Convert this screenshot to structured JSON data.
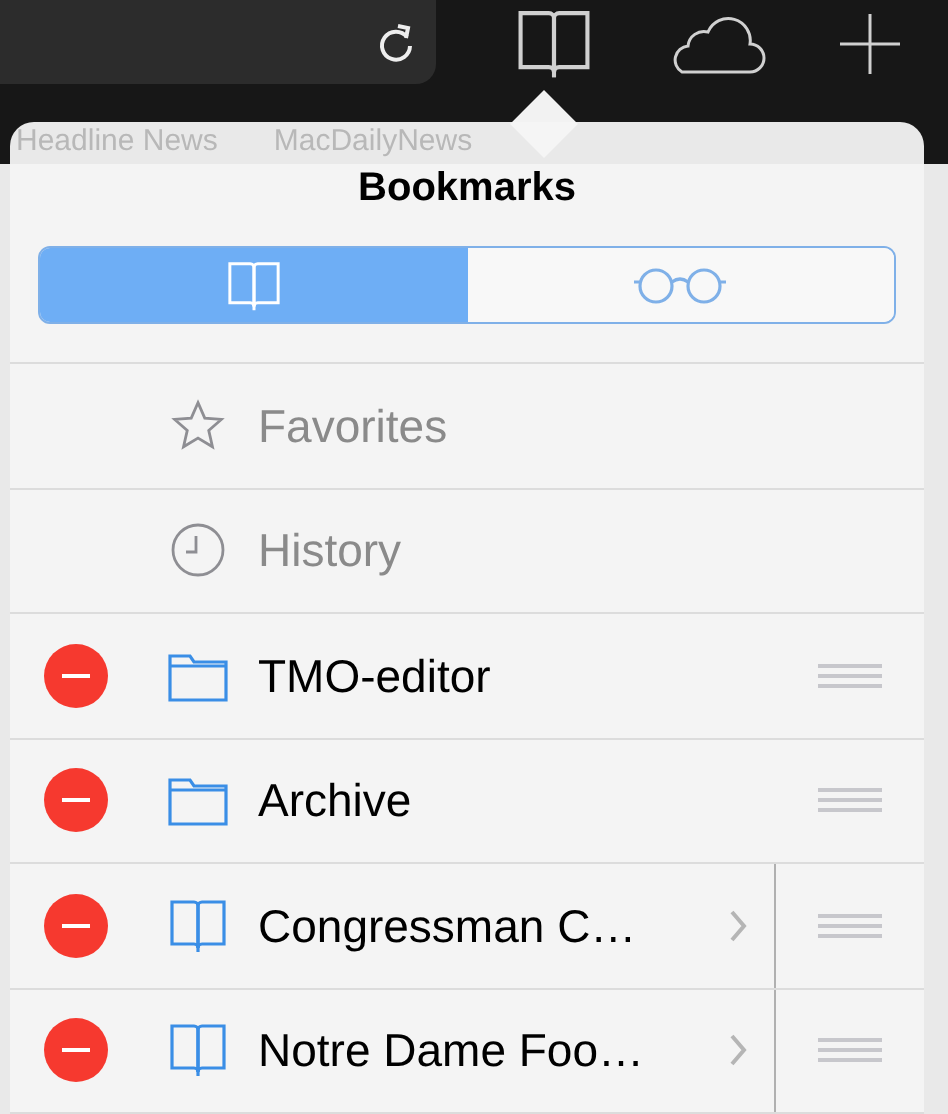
{
  "favorites_bar": [
    "Headline News",
    "MacDailyNews"
  ],
  "popover": {
    "title": "Bookmarks",
    "segments": [
      {
        "kind": "bookmarks",
        "selected": true
      },
      {
        "kind": "reading-list",
        "selected": false
      }
    ],
    "rows": [
      {
        "kind": "favorites",
        "label": "Favorites"
      },
      {
        "kind": "history",
        "label": "History"
      },
      {
        "kind": "folder",
        "label": "TMO-editor"
      },
      {
        "kind": "folder",
        "label": "Archive"
      },
      {
        "kind": "bookmark",
        "label": "Congressman C…"
      },
      {
        "kind": "bookmark",
        "label": "Notre Dame Foo…"
      }
    ]
  }
}
